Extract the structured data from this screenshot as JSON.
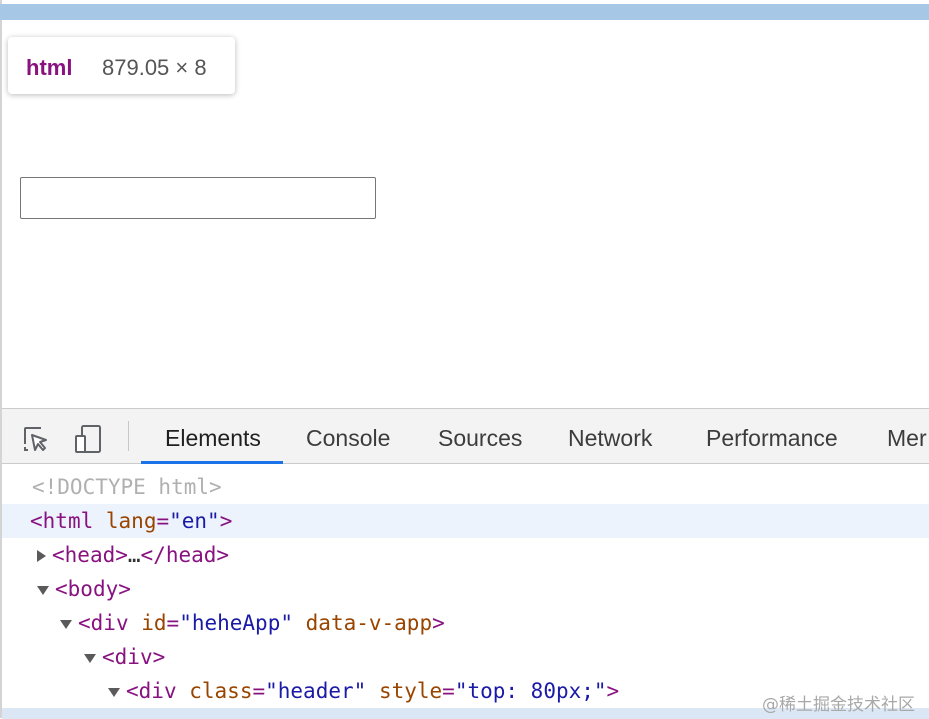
{
  "viewport": {
    "tooltip": {
      "tag": "html",
      "size": "879.05 × 8"
    }
  },
  "devtools": {
    "icons": [
      "inspect-element-icon",
      "device-toolbar-icon"
    ],
    "tabs": [
      {
        "label": "Elements",
        "active": true
      },
      {
        "label": "Console"
      },
      {
        "label": "Sources"
      },
      {
        "label": "Network"
      },
      {
        "label": "Performance"
      },
      {
        "label": "Mer"
      }
    ],
    "accent_color": "#1a73e8",
    "tree": {
      "doctype": "<!DOCTYPE html>",
      "html": {
        "open": "<",
        "tag": "html",
        "attr": "lang",
        "eq": "=",
        "val": "\"en\"",
        "close": ">"
      },
      "head": {
        "open": "<",
        "tag": "head",
        "mid": ">",
        "ellipsis": "…",
        "end_open": "</",
        "end_tag": "head",
        "end_close": ">"
      },
      "body": {
        "open": "<",
        "tag": "body",
        "close": ">"
      },
      "app": {
        "open": "<",
        "tag": "div",
        "attr1": "id",
        "eq": "=",
        "val1": "\"heheApp\"",
        "attr2": "data-v-app",
        "close": ">"
      },
      "div": {
        "open": "<",
        "tag": "div",
        "close": ">"
      },
      "header": {
        "open": "<",
        "tag": "div",
        "attr1": "class",
        "eq": "=",
        "val1": "\"header\"",
        "attr2": "style",
        "val2": "\"top: 80px;\"",
        "close": ">"
      }
    }
  },
  "watermark": "@稀土掘金技术社区"
}
